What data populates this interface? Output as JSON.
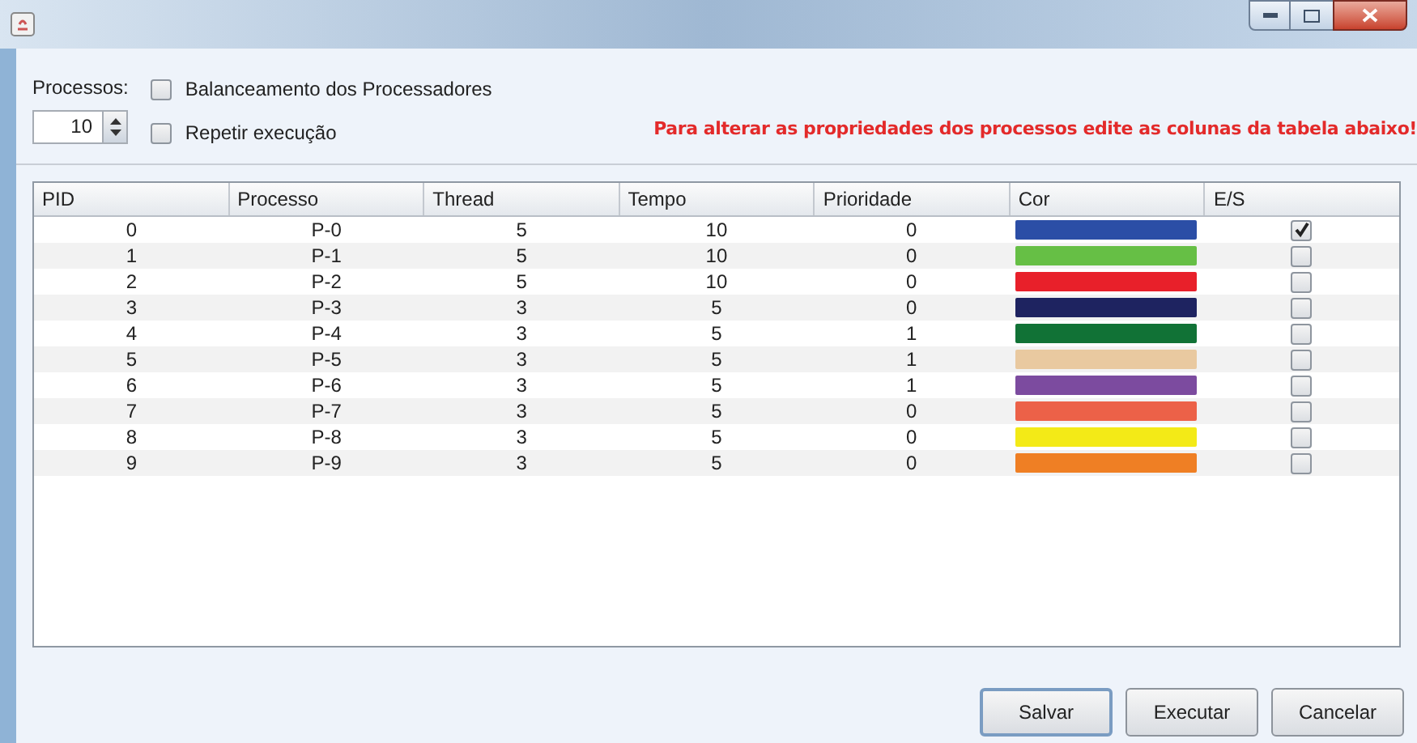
{
  "options": {
    "processes_label": "Processos:",
    "processes_value": "10",
    "balance": {
      "label": "Balanceamento dos Processadores",
      "checked": false
    },
    "repeat": {
      "label": "Repetir execução",
      "checked": false
    },
    "hint": "Para alterar as propriedades dos processos edite as colunas da tabela abaixo!"
  },
  "table": {
    "columns": [
      "PID",
      "Processo",
      "Thread",
      "Tempo",
      "Prioridade",
      "Cor",
      "E/S"
    ],
    "rows": [
      {
        "pid": "0",
        "process": "P-0",
        "thread": "5",
        "time": "10",
        "priority": "0",
        "color": "#2b4ea6",
        "io": true
      },
      {
        "pid": "1",
        "process": "P-1",
        "thread": "5",
        "time": "10",
        "priority": "0",
        "color": "#66bf45",
        "io": false
      },
      {
        "pid": "2",
        "process": "P-2",
        "thread": "5",
        "time": "10",
        "priority": "0",
        "color": "#e8202a",
        "io": false
      },
      {
        "pid": "3",
        "process": "P-3",
        "thread": "3",
        "time": "5",
        "priority": "0",
        "color": "#1e2360",
        "io": false
      },
      {
        "pid": "4",
        "process": "P-4",
        "thread": "3",
        "time": "5",
        "priority": "1",
        "color": "#117236",
        "io": false
      },
      {
        "pid": "5",
        "process": "P-5",
        "thread": "3",
        "time": "5",
        "priority": "1",
        "color": "#e9c9a0",
        "io": false
      },
      {
        "pid": "6",
        "process": "P-6",
        "thread": "3",
        "time": "5",
        "priority": "1",
        "color": "#7c4b9f",
        "io": false
      },
      {
        "pid": "7",
        "process": "P-7",
        "thread": "3",
        "time": "5",
        "priority": "0",
        "color": "#ec6148",
        "io": false
      },
      {
        "pid": "8",
        "process": "P-8",
        "thread": "3",
        "time": "5",
        "priority": "0",
        "color": "#f3ea17",
        "io": false
      },
      {
        "pid": "9",
        "process": "P-9",
        "thread": "3",
        "time": "5",
        "priority": "0",
        "color": "#ef7f24",
        "io": false
      }
    ]
  },
  "buttons": [
    "Salvar",
    "Executar",
    "Cancelar"
  ]
}
